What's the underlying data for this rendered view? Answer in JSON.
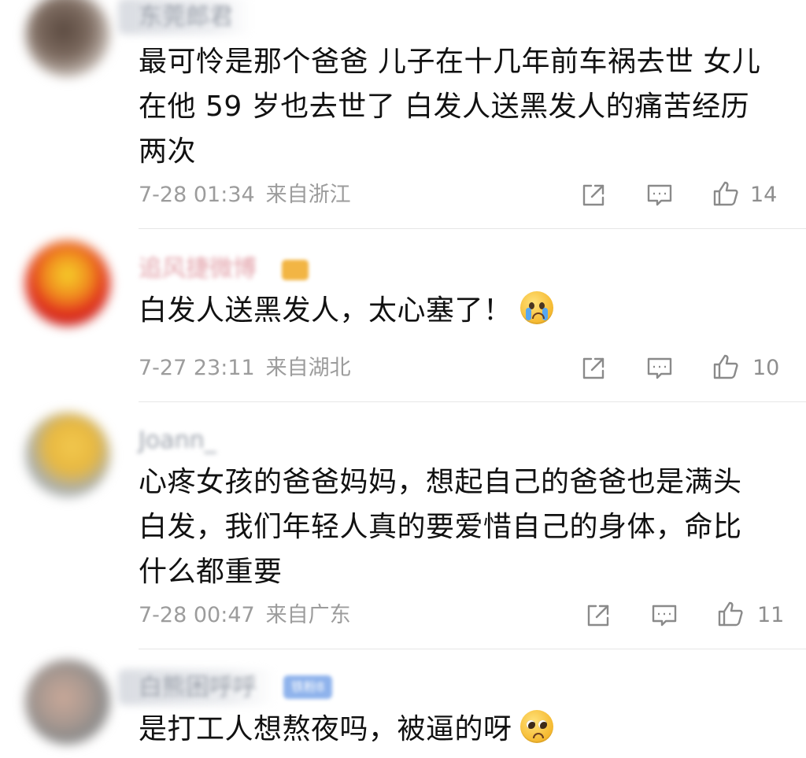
{
  "comments": [
    {
      "username": "东莞郎君",
      "text_lines": [
        "最可怜是那个爸爸 儿子在十几年前车祸去世 女儿",
        "在他 59 岁也去世了 白发人送黑发人的痛苦经历",
        "两次"
      ],
      "time": "7-28 01:34",
      "location": "来自浙江",
      "likes": "14",
      "avatar_colors": [
        "#5b4a40",
        "#9a8a80",
        "#d9d0c8"
      ],
      "icons": [
        "share-icon",
        "comment-icon",
        "thumbs-up-icon"
      ]
    },
    {
      "username": "追风捷微博",
      "text_lines": [
        "白发人送黑发人，太心塞了！"
      ],
      "emoji": "crying-face-emoji",
      "time": "7-27 23:11",
      "location": "来自湖北",
      "likes": "10",
      "avatar_colors": [
        "#f2c418",
        "#e8321e",
        "#b8141a"
      ],
      "icons": [
        "share-icon",
        "comment-icon",
        "thumbs-up-icon"
      ]
    },
    {
      "username": "Joann_",
      "text_lines": [
        "心疼女孩的爸爸妈妈，想起自己的爸爸也是满头",
        "白发，我们年轻人真的要爱惜自己的身体，命比",
        "什么都重要"
      ],
      "time": "7-28 00:47",
      "location": "来自广东",
      "likes": "11",
      "avatar_colors": [
        "#f0c64c",
        "#9aa4a8",
        "#d8d2c0"
      ],
      "icons": [
        "share-icon",
        "comment-icon",
        "thumbs-up-icon"
      ]
    },
    {
      "username": "白熊困呼呼",
      "badge": "铁粉8",
      "text_lines": [
        "是打工人想熬夜吗，被逼的呀"
      ],
      "emoji": "pleading-face-emoji",
      "avatar_colors": [
        "#c9a898",
        "#8a8a8a",
        "#e2d8d0"
      ]
    }
  ],
  "colors": {
    "text": "#111111",
    "meta": "#9c9c9c",
    "icon": "#8a8a8a",
    "divider": "#e6e6e6",
    "username_blurred": "#9aa0aa"
  }
}
